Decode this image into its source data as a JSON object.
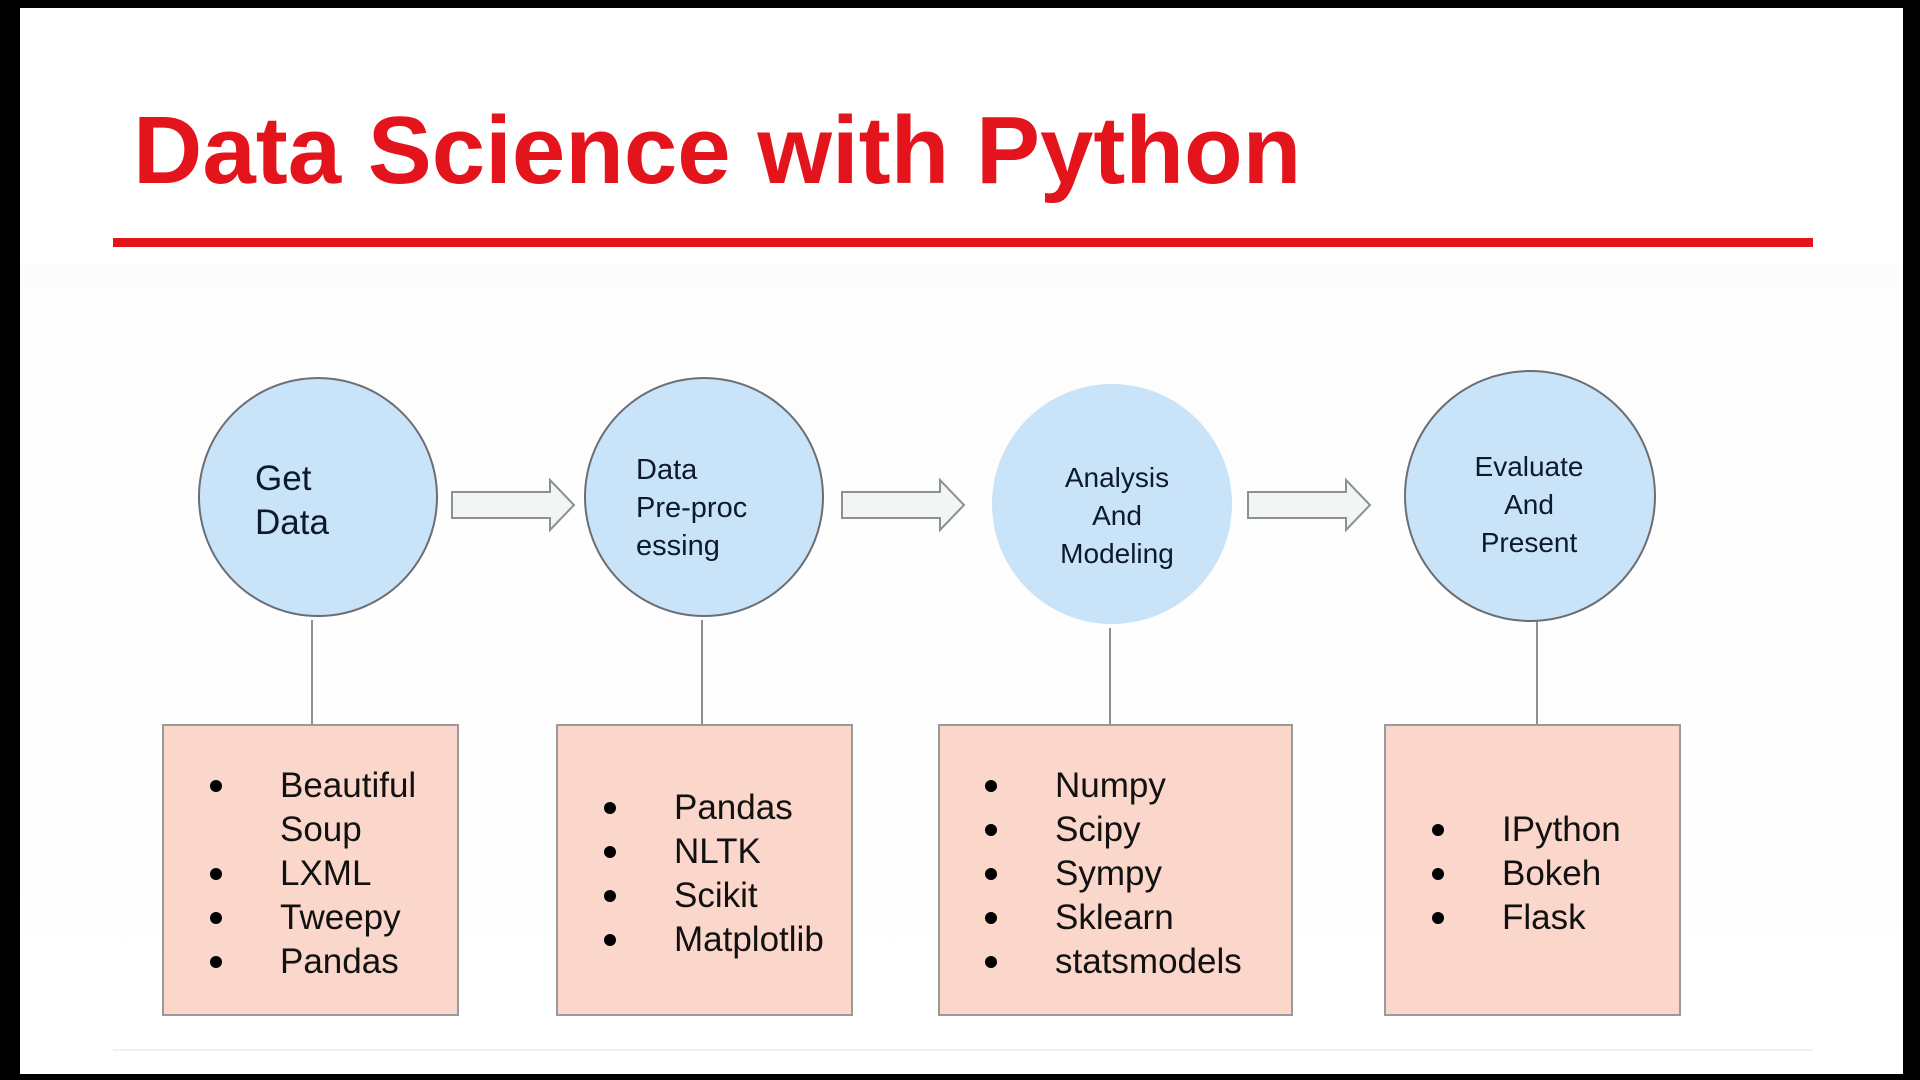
{
  "title": "Data Science with Python",
  "colors": {
    "title": "#e3141b",
    "circle_fill": "#c9e3f8",
    "box_fill": "#fbd6cb"
  },
  "stages": [
    {
      "label_lines": [
        "Get",
        "Data"
      ],
      "tools": [
        {
          "bullet": true,
          "text": "Beautiful"
        },
        {
          "bullet": false,
          "text": "Soup"
        },
        {
          "bullet": true,
          "text": "LXML"
        },
        {
          "bullet": true,
          "text": "Tweepy"
        },
        {
          "bullet": true,
          "text": "Pandas"
        }
      ]
    },
    {
      "label_lines": [
        "Data",
        "Pre-proc",
        "essing"
      ],
      "tools": [
        {
          "bullet": true,
          "text": "Pandas"
        },
        {
          "bullet": true,
          "text": "NLTK"
        },
        {
          "bullet": true,
          "text": "Scikit"
        },
        {
          "bullet": true,
          "text": "Matplotlib"
        }
      ]
    },
    {
      "label_lines": [
        "Analysis",
        "And",
        "Modeling"
      ],
      "tools": [
        {
          "bullet": true,
          "text": "Numpy"
        },
        {
          "bullet": true,
          "text": "Scipy"
        },
        {
          "bullet": true,
          "text": "Sympy"
        },
        {
          "bullet": true,
          "text": "Sklearn"
        },
        {
          "bullet": true,
          "text": "statsmodels"
        }
      ]
    },
    {
      "label_lines": [
        "Evaluate",
        "And",
        "Present"
      ],
      "tools": [
        {
          "bullet": true,
          "text": "IPython"
        },
        {
          "bullet": true,
          "text": "Bokeh"
        },
        {
          "bullet": true,
          "text": "Flask"
        }
      ]
    }
  ]
}
